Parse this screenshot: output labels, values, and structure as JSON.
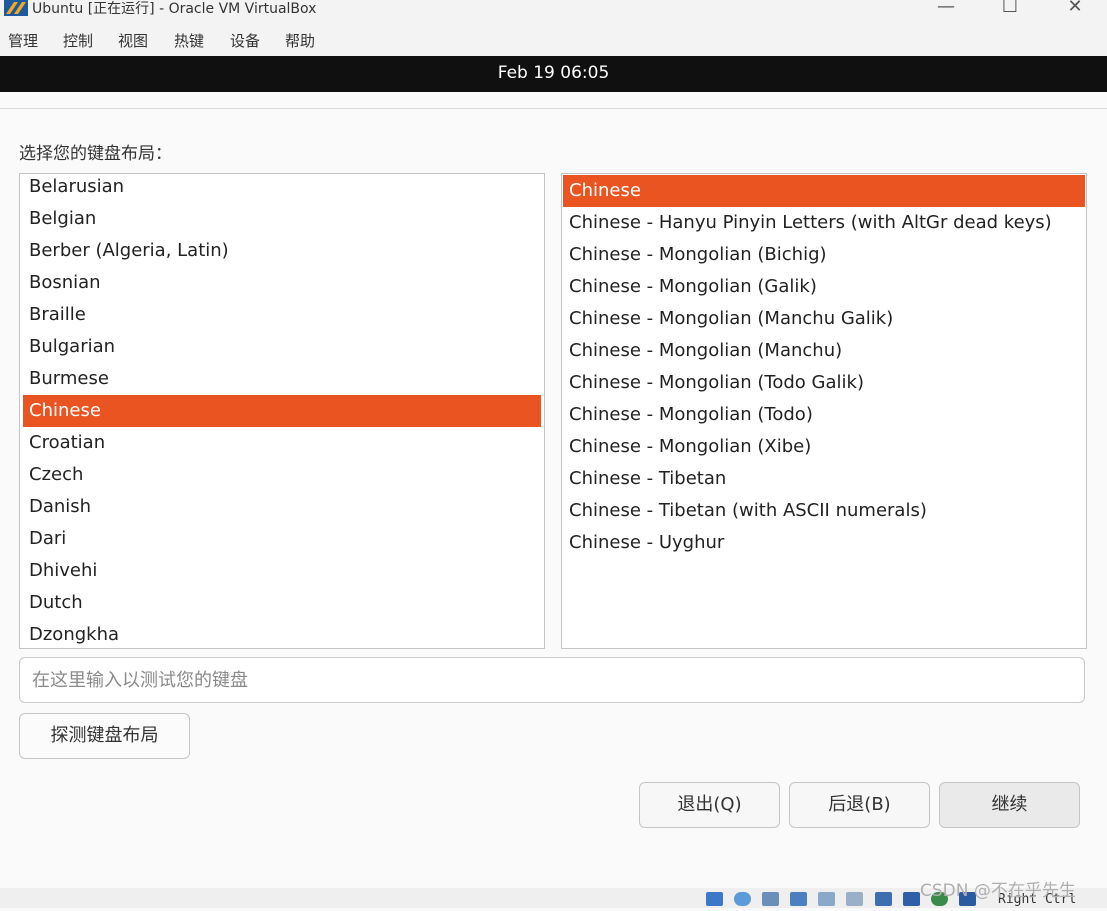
{
  "window": {
    "title": "Ubuntu [正在运行] - Oracle VM VirtualBox",
    "minimize_glyph": "—",
    "maximize_glyph": "☐",
    "close_glyph": "✕"
  },
  "menu": [
    "管理",
    "控制",
    "视图",
    "热键",
    "设备",
    "帮助"
  ],
  "topbar": {
    "clock": "Feb 19  06:05"
  },
  "installer": {
    "prompt": "选择您的键盘布局：",
    "layouts": [
      "Belarusian",
      "Belgian",
      "Berber (Algeria, Latin)",
      "Bosnian",
      "Braille",
      "Bulgarian",
      "Burmese",
      "Chinese",
      "Croatian",
      "Czech",
      "Danish",
      "Dari",
      "Dhivehi",
      "Dutch",
      "Dzongkha"
    ],
    "selected_layout": "Chinese",
    "variants": [
      "Chinese",
      "Chinese - Hanyu Pinyin Letters (with AltGr dead keys)",
      "Chinese - Mongolian (Bichig)",
      "Chinese - Mongolian (Galik)",
      "Chinese - Mongolian (Manchu Galik)",
      "Chinese - Mongolian (Manchu)",
      "Chinese - Mongolian (Todo Galik)",
      "Chinese - Mongolian (Todo)",
      "Chinese - Mongolian (Xibe)",
      "Chinese - Tibetan",
      "Chinese - Tibetan (with ASCII numerals)",
      "Chinese - Uyghur"
    ],
    "selected_variant": "Chinese",
    "test_placeholder": "在这里输入以测试您的键盘",
    "detect_button": "探测键盘布局",
    "quit_button": "退出(Q)",
    "back_button": "后退(B)",
    "continue_button": "继续"
  },
  "statusbar": {
    "host_key": "Right Ctrl"
  },
  "watermark": "CSDN @不在乎先生",
  "colors": {
    "accent": "#e95420",
    "topbar": "#101010"
  }
}
